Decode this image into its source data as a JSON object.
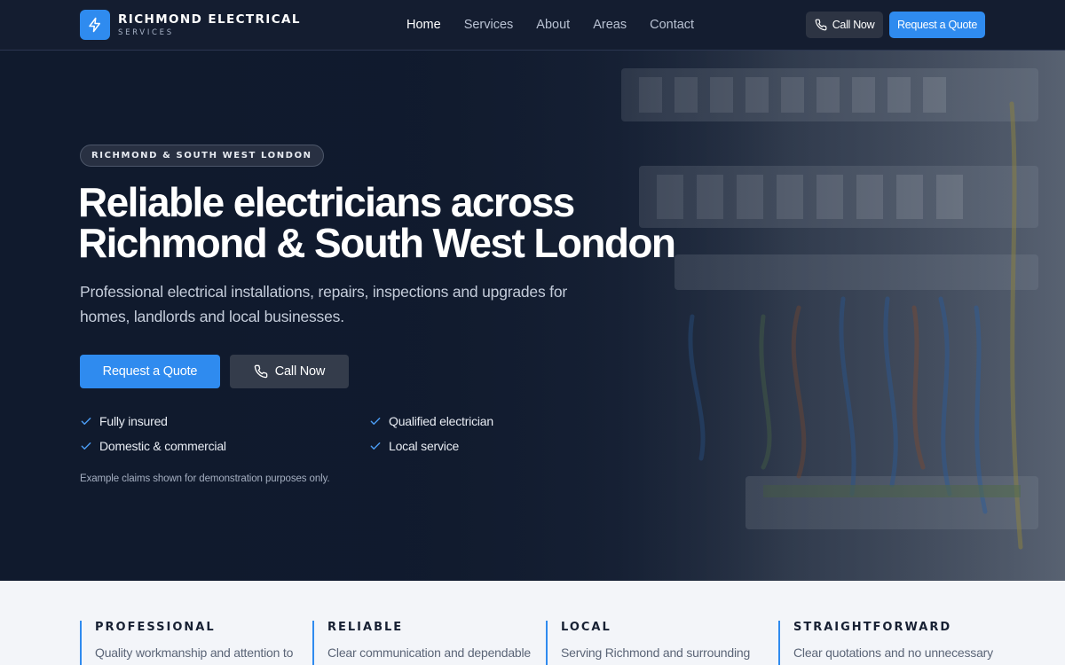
{
  "brand": {
    "name": "RICHMOND ELECTRICAL",
    "tagline": "SERVICES",
    "logo_icon": "lightning-bolt-icon",
    "accent_color": "#2f8bef"
  },
  "nav": {
    "items": [
      {
        "label": "Home",
        "active": true
      },
      {
        "label": "Services",
        "active": false
      },
      {
        "label": "About",
        "active": false
      },
      {
        "label": "Areas",
        "active": false
      },
      {
        "label": "Contact",
        "active": false
      }
    ]
  },
  "header_actions": {
    "call_label": "Call Now",
    "call_icon": "phone-icon",
    "quote_label": "Request a Quote"
  },
  "hero": {
    "badge": "RICHMOND & SOUTH WEST LONDON",
    "title_line1": "Reliable electricians across",
    "title_line2": "Richmond & South West London",
    "subtitle": "Professional electrical installations, repairs, inspections and upgrades for homes, landlords and local businesses.",
    "primary_cta": "Request a Quote",
    "secondary_cta": "Call Now",
    "features": [
      {
        "label": "Fully insured",
        "icon": "check-icon"
      },
      {
        "label": "Qualified electrician",
        "icon": "check-icon"
      },
      {
        "label": "Domestic & commercial",
        "icon": "check-icon"
      },
      {
        "label": "Local service",
        "icon": "check-icon"
      }
    ],
    "disclaimer": "Example claims shown for demonstration purposes only."
  },
  "values": [
    {
      "title": "PROFESSIONAL",
      "text": "Quality workmanship and attention to"
    },
    {
      "title": "RELIABLE",
      "text": "Clear communication and dependable"
    },
    {
      "title": "LOCAL",
      "text": "Serving Richmond and surrounding"
    },
    {
      "title": "STRAIGHTFORWARD",
      "text": "Clear quotations and no unnecessary"
    }
  ]
}
